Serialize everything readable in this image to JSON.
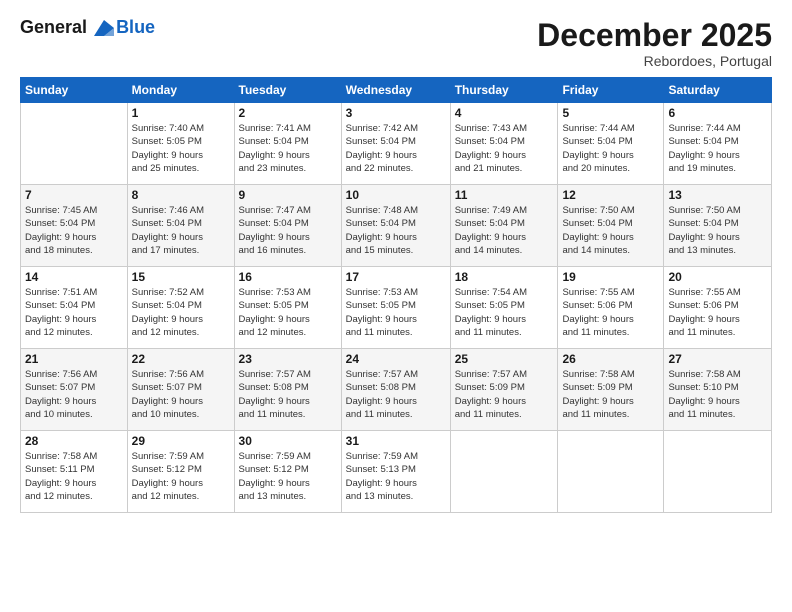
{
  "header": {
    "logo_line1": "General",
    "logo_line2": "Blue",
    "month": "December 2025",
    "location": "Rebordoes, Portugal"
  },
  "weekdays": [
    "Sunday",
    "Monday",
    "Tuesday",
    "Wednesday",
    "Thursday",
    "Friday",
    "Saturday"
  ],
  "weeks": [
    [
      {
        "day": "",
        "info": ""
      },
      {
        "day": "1",
        "info": "Sunrise: 7:40 AM\nSunset: 5:05 PM\nDaylight: 9 hours\nand 25 minutes."
      },
      {
        "day": "2",
        "info": "Sunrise: 7:41 AM\nSunset: 5:04 PM\nDaylight: 9 hours\nand 23 minutes."
      },
      {
        "day": "3",
        "info": "Sunrise: 7:42 AM\nSunset: 5:04 PM\nDaylight: 9 hours\nand 22 minutes."
      },
      {
        "day": "4",
        "info": "Sunrise: 7:43 AM\nSunset: 5:04 PM\nDaylight: 9 hours\nand 21 minutes."
      },
      {
        "day": "5",
        "info": "Sunrise: 7:44 AM\nSunset: 5:04 PM\nDaylight: 9 hours\nand 20 minutes."
      },
      {
        "day": "6",
        "info": "Sunrise: 7:44 AM\nSunset: 5:04 PM\nDaylight: 9 hours\nand 19 minutes."
      }
    ],
    [
      {
        "day": "7",
        "info": "Sunrise: 7:45 AM\nSunset: 5:04 PM\nDaylight: 9 hours\nand 18 minutes."
      },
      {
        "day": "8",
        "info": "Sunrise: 7:46 AM\nSunset: 5:04 PM\nDaylight: 9 hours\nand 17 minutes."
      },
      {
        "day": "9",
        "info": "Sunrise: 7:47 AM\nSunset: 5:04 PM\nDaylight: 9 hours\nand 16 minutes."
      },
      {
        "day": "10",
        "info": "Sunrise: 7:48 AM\nSunset: 5:04 PM\nDaylight: 9 hours\nand 15 minutes."
      },
      {
        "day": "11",
        "info": "Sunrise: 7:49 AM\nSunset: 5:04 PM\nDaylight: 9 hours\nand 14 minutes."
      },
      {
        "day": "12",
        "info": "Sunrise: 7:50 AM\nSunset: 5:04 PM\nDaylight: 9 hours\nand 14 minutes."
      },
      {
        "day": "13",
        "info": "Sunrise: 7:50 AM\nSunset: 5:04 PM\nDaylight: 9 hours\nand 13 minutes."
      }
    ],
    [
      {
        "day": "14",
        "info": "Sunrise: 7:51 AM\nSunset: 5:04 PM\nDaylight: 9 hours\nand 12 minutes."
      },
      {
        "day": "15",
        "info": "Sunrise: 7:52 AM\nSunset: 5:04 PM\nDaylight: 9 hours\nand 12 minutes."
      },
      {
        "day": "16",
        "info": "Sunrise: 7:53 AM\nSunset: 5:05 PM\nDaylight: 9 hours\nand 12 minutes."
      },
      {
        "day": "17",
        "info": "Sunrise: 7:53 AM\nSunset: 5:05 PM\nDaylight: 9 hours\nand 11 minutes."
      },
      {
        "day": "18",
        "info": "Sunrise: 7:54 AM\nSunset: 5:05 PM\nDaylight: 9 hours\nand 11 minutes."
      },
      {
        "day": "19",
        "info": "Sunrise: 7:55 AM\nSunset: 5:06 PM\nDaylight: 9 hours\nand 11 minutes."
      },
      {
        "day": "20",
        "info": "Sunrise: 7:55 AM\nSunset: 5:06 PM\nDaylight: 9 hours\nand 11 minutes."
      }
    ],
    [
      {
        "day": "21",
        "info": "Sunrise: 7:56 AM\nSunset: 5:07 PM\nDaylight: 9 hours\nand 10 minutes."
      },
      {
        "day": "22",
        "info": "Sunrise: 7:56 AM\nSunset: 5:07 PM\nDaylight: 9 hours\nand 10 minutes."
      },
      {
        "day": "23",
        "info": "Sunrise: 7:57 AM\nSunset: 5:08 PM\nDaylight: 9 hours\nand 11 minutes."
      },
      {
        "day": "24",
        "info": "Sunrise: 7:57 AM\nSunset: 5:08 PM\nDaylight: 9 hours\nand 11 minutes."
      },
      {
        "day": "25",
        "info": "Sunrise: 7:57 AM\nSunset: 5:09 PM\nDaylight: 9 hours\nand 11 minutes."
      },
      {
        "day": "26",
        "info": "Sunrise: 7:58 AM\nSunset: 5:09 PM\nDaylight: 9 hours\nand 11 minutes."
      },
      {
        "day": "27",
        "info": "Sunrise: 7:58 AM\nSunset: 5:10 PM\nDaylight: 9 hours\nand 11 minutes."
      }
    ],
    [
      {
        "day": "28",
        "info": "Sunrise: 7:58 AM\nSunset: 5:11 PM\nDaylight: 9 hours\nand 12 minutes."
      },
      {
        "day": "29",
        "info": "Sunrise: 7:59 AM\nSunset: 5:12 PM\nDaylight: 9 hours\nand 12 minutes."
      },
      {
        "day": "30",
        "info": "Sunrise: 7:59 AM\nSunset: 5:12 PM\nDaylight: 9 hours\nand 13 minutes."
      },
      {
        "day": "31",
        "info": "Sunrise: 7:59 AM\nSunset: 5:13 PM\nDaylight: 9 hours\nand 13 minutes."
      },
      {
        "day": "",
        "info": ""
      },
      {
        "day": "",
        "info": ""
      },
      {
        "day": "",
        "info": ""
      }
    ]
  ]
}
